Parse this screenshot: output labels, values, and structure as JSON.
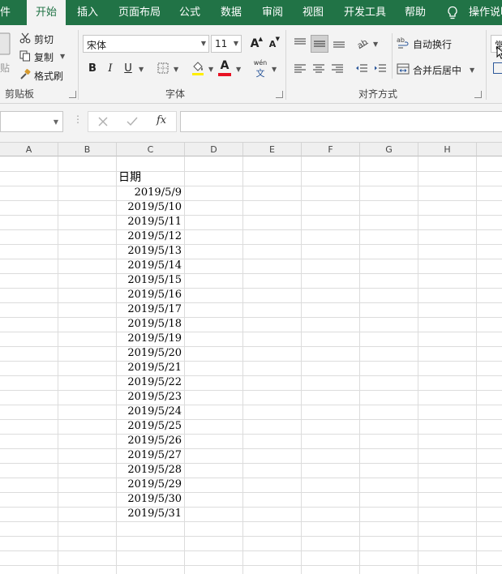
{
  "tabs": [
    {
      "label": "件",
      "active": false
    },
    {
      "label": "开始",
      "active": true
    },
    {
      "label": "插入",
      "active": false
    },
    {
      "label": "页面布局",
      "active": false
    },
    {
      "label": "公式",
      "active": false
    },
    {
      "label": "数据",
      "active": false
    },
    {
      "label": "审阅",
      "active": false
    },
    {
      "label": "视图",
      "active": false
    },
    {
      "label": "开发工具",
      "active": false
    },
    {
      "label": "帮助",
      "active": false
    }
  ],
  "tell_me": "操作说明",
  "clipboard": {
    "paste_label": "贴",
    "cut_label": "剪切",
    "copy_label": "复制",
    "format_painter_label": "格式刷",
    "group_label": "剪贴板"
  },
  "font": {
    "font_name": "宋体",
    "font_size": "11",
    "bold": "B",
    "italic": "I",
    "underline": "U",
    "group_label": "字体",
    "grow_icon": "A",
    "shrink_icon": "A",
    "phonetic_top": "wén",
    "phonetic_bottom": "文",
    "font_color": "#e81123",
    "fill_color": "#ffee00"
  },
  "alignment": {
    "wrap_text_label": "自动换行",
    "merge_center_label": "合并后居中",
    "group_label": "对齐方式"
  },
  "number": {
    "format_partial": "常"
  },
  "formula_bar": {
    "fx": "fx",
    "name_box_value": "",
    "formula_value": ""
  },
  "sheet": {
    "columns": [
      "A",
      "B",
      "C",
      "D",
      "E",
      "F",
      "G",
      "H"
    ],
    "header_cell": "日期",
    "dates": [
      "2019/5/9",
      "2019/5/10",
      "2019/5/11",
      "2019/5/12",
      "2019/5/13",
      "2019/5/14",
      "2019/5/15",
      "2019/5/16",
      "2019/5/17",
      "2019/5/18",
      "2019/5/19",
      "2019/5/20",
      "2019/5/21",
      "2019/5/22",
      "2019/5/23",
      "2019/5/24",
      "2019/5/25",
      "2019/5/26",
      "2019/5/27",
      "2019/5/28",
      "2019/5/29",
      "2019/5/30",
      "2019/5/31"
    ]
  },
  "colors": {
    "accent": "#217346",
    "ribbon_bg": "#f3f3f3",
    "gridline": "#dcdcdc"
  },
  "icons": {
    "cut": "scissors-icon",
    "copy": "copy-icon",
    "format_painter": "paintbrush-icon",
    "tell_me": "lightbulb-icon",
    "borders": "borders-icon",
    "fill": "fill-bucket-icon",
    "orientation": "text-orientation-icon",
    "cancel": "close-icon",
    "enter": "check-icon"
  }
}
